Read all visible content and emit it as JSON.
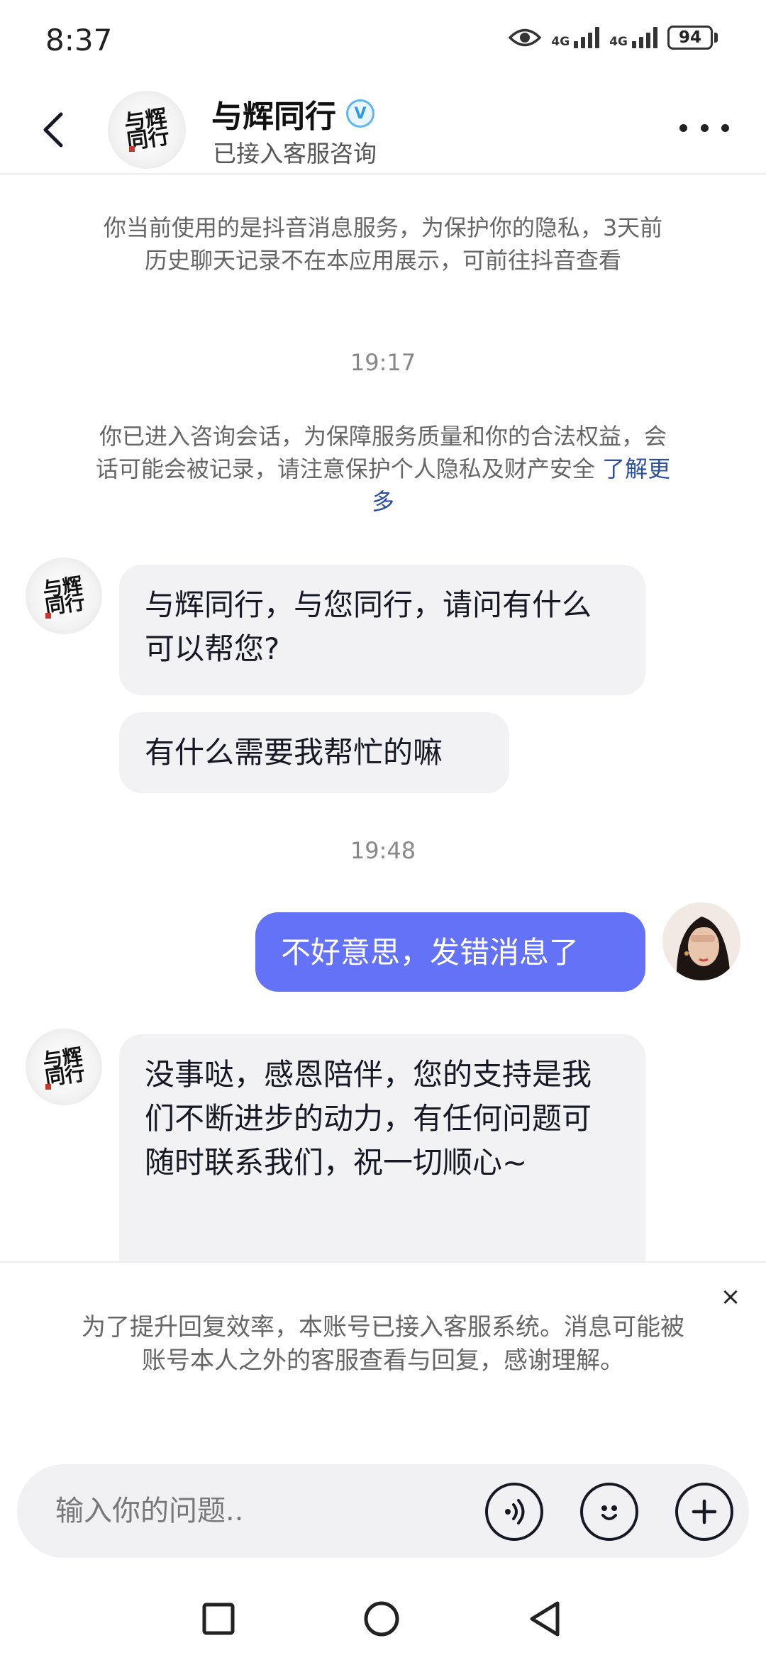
{
  "status_bar": {
    "time": "8:37",
    "network_1": "4G",
    "network_2": "4G",
    "battery": "94"
  },
  "header": {
    "title": "与辉同行",
    "subtitle": "已接入客服咨询",
    "avatar_text": "与辉同行"
  },
  "chat": {
    "privacy_notice": "你当前使用的是抖音消息服务，为保护你的隐私，3天前历史聊天记录不在本应用展示，可前往抖音查看",
    "timestamp_1": "19:17",
    "consult_notice": "你已进入咨询会话，为保障服务质量和你的合法权益，会话可能会被记录，请注意保护个人隐私及财产安全",
    "learn_more": "了解更多",
    "messages": [
      {
        "from": "agent",
        "text": "与辉同行，与您同行，请问有什么可以帮您?"
      },
      {
        "from": "agent",
        "text": "有什么需要我帮忙的嘛"
      },
      {
        "from": "user",
        "text": "不好意思，发错消息了"
      },
      {
        "from": "agent",
        "text": "没事哒，感恩陪伴，您的支持是我们不断进步的动力，有任何问题可随时联系我们，祝一切顺心~"
      }
    ],
    "timestamp_2": "19:48"
  },
  "panel": {
    "notice": "为了提升回复效率，本账号已接入客服系统。消息可能被账号本人之外的客服查看与回复，感谢理解。",
    "close_label": "×",
    "input_placeholder": "输入你的问题.."
  },
  "icons": {
    "back": "chevron-left-icon",
    "more": "more-dots-icon",
    "verified": "verified-badge-icon",
    "voice": "voice-icon",
    "emoji": "emoji-icon",
    "add": "plus-icon"
  },
  "colors": {
    "user_bubble": "#6472f7",
    "agent_bubble": "#f2f2f4",
    "verified": "#2f9be3",
    "link": "#2b4f9e"
  }
}
